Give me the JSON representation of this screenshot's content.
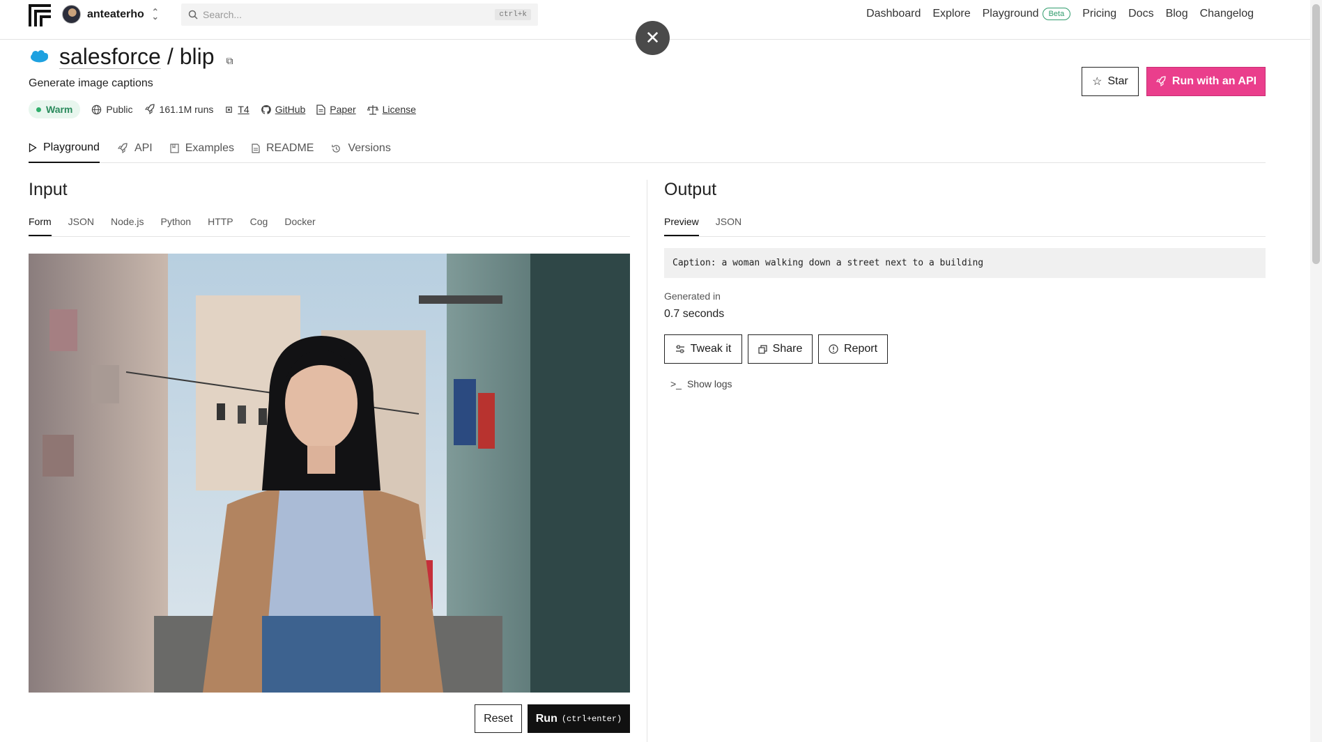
{
  "nav": {
    "username": "anteaterho",
    "search_placeholder": "Search...",
    "search_shortcut": "ctrl+k",
    "links": [
      "Dashboard",
      "Explore",
      "Playground",
      "Pricing",
      "Docs",
      "Blog",
      "Changelog"
    ],
    "playground_badge": "Beta"
  },
  "model": {
    "owner": "salesforce",
    "separator": "/",
    "name": "blip",
    "description": "Generate image captions",
    "status": "Warm",
    "visibility": "Public",
    "runs": "161.1M runs",
    "hardware": "T4",
    "github": "GitHub",
    "paper": "Paper",
    "license": "License"
  },
  "actions": {
    "star": "Star",
    "run_api": "Run with an API"
  },
  "tabs": [
    "Playground",
    "API",
    "Examples",
    "README",
    "Versions"
  ],
  "input": {
    "title": "Input",
    "subtabs": [
      "Form",
      "JSON",
      "Node.js",
      "Python",
      "HTTP",
      "Cog",
      "Docker"
    ],
    "reset": "Reset",
    "run": "Run",
    "run_hint": "(ctrl+enter)"
  },
  "output": {
    "title": "Output",
    "subtabs": [
      "Preview",
      "JSON"
    ],
    "caption": "Caption: a woman walking down a street next to a building",
    "generated_label": "Generated in",
    "generated_value": "0.7 seconds",
    "tweak": "Tweak it",
    "share": "Share",
    "report": "Report",
    "show_logs": "Show logs"
  },
  "colors": {
    "accent": "#ea3e8c",
    "warm": "#2fae6b"
  }
}
